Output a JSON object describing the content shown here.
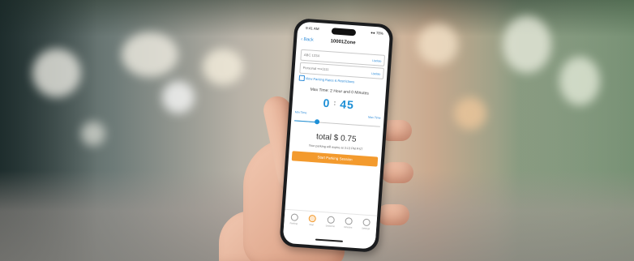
{
  "status_bar": {
    "time": "9:41 AM",
    "icons": "●● 78%"
  },
  "header": {
    "back_label": "‹ Back",
    "title": "10001Zone"
  },
  "fields": [
    {
      "value": "ABC 1234",
      "action": "Update"
    },
    {
      "value": "Personal ••••1111",
      "action": "Update"
    }
  ],
  "rates_link": "View Parking Rates & Restrictions",
  "max_time_text": "Max Time: 2 Hour and 0 Minutes",
  "timer": {
    "hours": "0",
    "minutes": "45"
  },
  "slider": {
    "min_label": "Min Time",
    "max_label": "Max Time",
    "value_fraction": 0.26
  },
  "total_text": "total $ 0.75",
  "expire_text": "Your parking will expire at 3:13 PM PST",
  "start_button": "Start Parking Session",
  "tabs": [
    {
      "label": "Parking",
      "icon": "car-icon",
      "active": false
    },
    {
      "label": "Start",
      "icon": "parking-icon",
      "active": true
    },
    {
      "label": "Sessions",
      "icon": "timer-icon",
      "active": false
    },
    {
      "label": "Vehicles",
      "icon": "tag-icon",
      "active": false
    },
    {
      "label": "Settings",
      "icon": "gear-icon",
      "active": false
    }
  ],
  "colors": {
    "accent": "#1d8fd6",
    "button": "#f39a2d"
  }
}
